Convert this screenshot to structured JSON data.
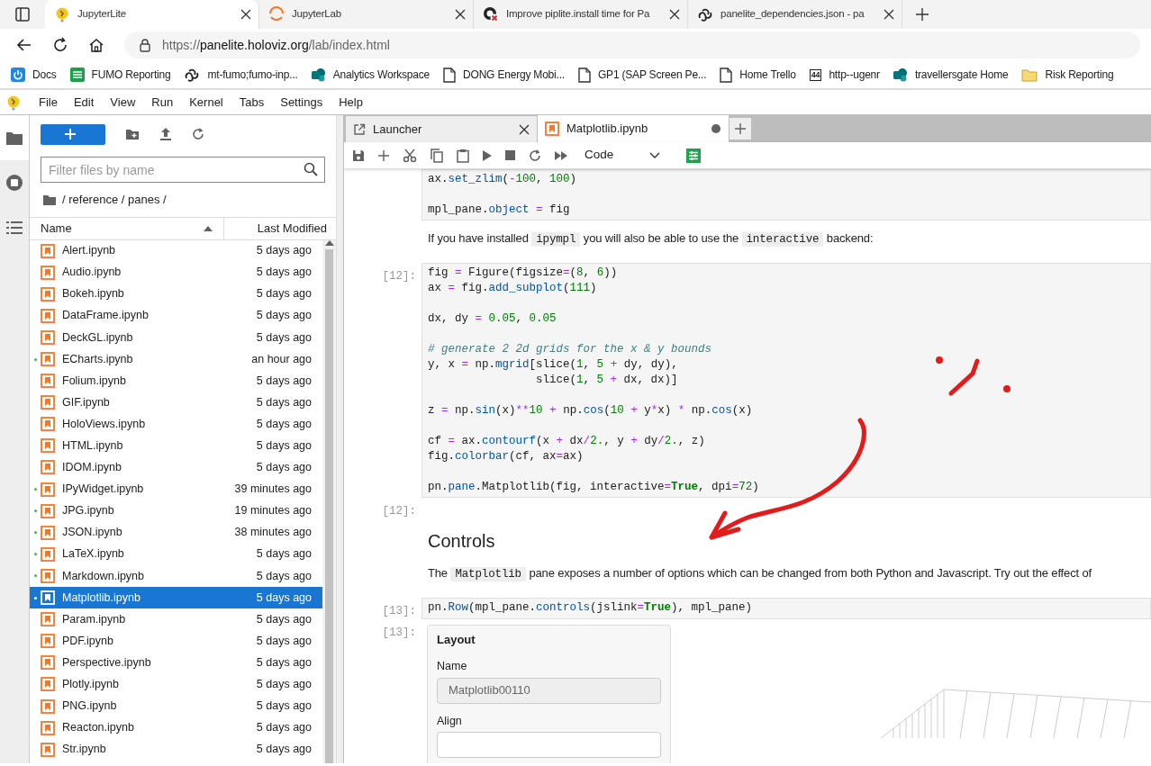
{
  "browser": {
    "tabs": [
      {
        "title": "JupyterLite",
        "kind": "jupyterlite",
        "selected": true
      },
      {
        "title": "JupyterLab",
        "kind": "jupyterlab",
        "selected": false
      },
      {
        "title": "Improve piplite.install time for Pa",
        "kind": "github-error",
        "selected": false
      },
      {
        "title": "panelite_dependencies.json - pa",
        "kind": "knot",
        "selected": false
      }
    ],
    "url": {
      "scheme": "https://",
      "host": "panelite.holoviz.org",
      "path": "/lab/index.html"
    },
    "bookmarks": [
      {
        "label": "Docs",
        "kind": "power"
      },
      {
        "label": "FUMO Reporting",
        "kind": "sheet"
      },
      {
        "label": "mt-fumo;fumo-inp...",
        "kind": "knot"
      },
      {
        "label": "Analytics Workspace",
        "kind": "circles"
      },
      {
        "label": "DONG Energy Mobi...",
        "kind": "page"
      },
      {
        "label": "GP1 (SAP Screen Pe...",
        "kind": "page"
      },
      {
        "label": "Home  Trello",
        "kind": "page"
      },
      {
        "label": "http--ugenr",
        "kind": "number",
        "badge": "44"
      },
      {
        "label": "travellersgate  Home",
        "kind": "circles"
      },
      {
        "label": "Risk Reporting",
        "kind": "folder"
      }
    ]
  },
  "menu": [
    "File",
    "Edit",
    "View",
    "Run",
    "Kernel",
    "Tabs",
    "Settings",
    "Help"
  ],
  "activity_bar": [
    {
      "kind": "files",
      "selected": true
    },
    {
      "kind": "running",
      "selected": false
    },
    {
      "kind": "toc",
      "selected": false
    }
  ],
  "file_browser": {
    "filter": {
      "placeholder": "Filter files by name"
    },
    "breadcrumb": "/ reference / panes /",
    "columns": [
      {
        "label": "Name",
        "sort_ascending": true
      },
      {
        "label": "Last Modified"
      }
    ],
    "files": [
      {
        "name": "Alert.ipynb",
        "modified": "5 days ago",
        "running": false,
        "selected": false
      },
      {
        "name": "Audio.ipynb",
        "modified": "5 days ago",
        "running": false,
        "selected": false
      },
      {
        "name": "Bokeh.ipynb",
        "modified": "5 days ago",
        "running": false,
        "selected": false
      },
      {
        "name": "DataFrame.ipynb",
        "modified": "5 days ago",
        "running": false,
        "selected": false
      },
      {
        "name": "DeckGL.ipynb",
        "modified": "5 days ago",
        "running": false,
        "selected": false
      },
      {
        "name": "ECharts.ipynb",
        "modified": "an hour ago",
        "running": true,
        "selected": false
      },
      {
        "name": "Folium.ipynb",
        "modified": "5 days ago",
        "running": false,
        "selected": false
      },
      {
        "name": "GIF.ipynb",
        "modified": "5 days ago",
        "running": false,
        "selected": false
      },
      {
        "name": "HoloViews.ipynb",
        "modified": "5 days ago",
        "running": false,
        "selected": false
      },
      {
        "name": "HTML.ipynb",
        "modified": "5 days ago",
        "running": false,
        "selected": false
      },
      {
        "name": "IDOM.ipynb",
        "modified": "5 days ago",
        "running": false,
        "selected": false
      },
      {
        "name": "IPyWidget.ipynb",
        "modified": "39 minutes ago",
        "running": true,
        "selected": false
      },
      {
        "name": "JPG.ipynb",
        "modified": "19 minutes ago",
        "running": true,
        "selected": false
      },
      {
        "name": "JSON.ipynb",
        "modified": "38 minutes ago",
        "running": true,
        "selected": false
      },
      {
        "name": "LaTeX.ipynb",
        "modified": "5 days ago",
        "running": true,
        "selected": false
      },
      {
        "name": "Markdown.ipynb",
        "modified": "5 days ago",
        "running": true,
        "selected": false
      },
      {
        "name": "Matplotlib.ipynb",
        "modified": "5 days ago",
        "running": true,
        "selected": true
      },
      {
        "name": "Param.ipynb",
        "modified": "5 days ago",
        "running": false,
        "selected": false
      },
      {
        "name": "PDF.ipynb",
        "modified": "5 days ago",
        "running": false,
        "selected": false
      },
      {
        "name": "Perspective.ipynb",
        "modified": "5 days ago",
        "running": false,
        "selected": false
      },
      {
        "name": "Plotly.ipynb",
        "modified": "5 days ago",
        "running": false,
        "selected": false
      },
      {
        "name": "PNG.ipynb",
        "modified": "5 days ago",
        "running": false,
        "selected": false
      },
      {
        "name": "Reacton.ipynb",
        "modified": "5 days ago",
        "running": false,
        "selected": false
      },
      {
        "name": "Str.ipynb",
        "modified": "5 days ago",
        "running": false,
        "selected": false
      }
    ]
  },
  "notebook_tabs": [
    {
      "title": "Launcher",
      "kind": "launcher",
      "selected": false,
      "dirty": false
    },
    {
      "title": "Matplotlib.ipynb",
      "kind": "notebook",
      "selected": true,
      "dirty": true
    }
  ],
  "toolbar": {
    "cell_type": "Code"
  },
  "cells": [
    {
      "kind": "code",
      "blocks": [
        [
          [
            {
              "text": "ax.",
              "kind": "name"
            },
            {
              "text": "set_zlim",
              "kind": "attr"
            },
            {
              "text": "(",
              "kind": "name"
            },
            {
              "text": "-",
              "kind": "op"
            },
            {
              "text": "100",
              "kind": "num"
            },
            {
              "text": ", ",
              "kind": "name"
            },
            {
              "text": "100",
              "kind": "num"
            },
            {
              "text": ")",
              "kind": "name"
            }
          ]
        ],
        [
          [
            {
              "text": "mpl_pane.",
              "kind": "name"
            },
            {
              "text": "object",
              "kind": "attr"
            },
            {
              "text": " = ",
              "kind": "op"
            },
            {
              "text": "fig",
              "kind": "name"
            }
          ]
        ]
      ]
    },
    {
      "kind": "markdown",
      "segments": [
        {
          "text": "If you have installed ",
          "kind": "plain"
        },
        {
          "text": "ipympl",
          "kind": "code"
        },
        {
          "text": " you will also be able to use the ",
          "kind": "plain"
        },
        {
          "text": "interactive",
          "kind": "code"
        },
        {
          "text": " backend:",
          "kind": "plain"
        }
      ]
    },
    {
      "kind": "code",
      "prompt": "[12]:",
      "blocks": [
        [
          [
            {
              "text": "fig",
              "kind": "name"
            },
            {
              "text": " = ",
              "kind": "op"
            },
            {
              "text": "Figure(figsize",
              "kind": "name"
            },
            {
              "text": "=",
              "kind": "op"
            },
            {
              "text": "(",
              "kind": "name"
            },
            {
              "text": "8",
              "kind": "num"
            },
            {
              "text": ", ",
              "kind": "name"
            },
            {
              "text": "6",
              "kind": "num"
            },
            {
              "text": "))",
              "kind": "name"
            }
          ],
          [
            {
              "text": "ax",
              "kind": "name"
            },
            {
              "text": " = ",
              "kind": "op"
            },
            {
              "text": "fig.",
              "kind": "name"
            },
            {
              "text": "add_subplot",
              "kind": "attr"
            },
            {
              "text": "(",
              "kind": "name"
            },
            {
              "text": "111",
              "kind": "num"
            },
            {
              "text": ")",
              "kind": "name"
            }
          ]
        ],
        [
          [
            {
              "text": "dx, dy",
              "kind": "name"
            },
            {
              "text": " = ",
              "kind": "op"
            },
            {
              "text": "0.05",
              "kind": "num"
            },
            {
              "text": ", ",
              "kind": "name"
            },
            {
              "text": "0.05",
              "kind": "num"
            }
          ]
        ],
        [
          [
            {
              "text": "# generate 2 2d grids for the x & y bounds",
              "kind": "comment"
            }
          ],
          [
            {
              "text": "y, x",
              "kind": "name"
            },
            {
              "text": " = ",
              "kind": "op"
            },
            {
              "text": "np.",
              "kind": "name"
            },
            {
              "text": "mgrid",
              "kind": "attr"
            },
            {
              "text": "[slice(",
              "kind": "name"
            },
            {
              "text": "1",
              "kind": "num"
            },
            {
              "text": ", ",
              "kind": "name"
            },
            {
              "text": "5",
              "kind": "num"
            },
            {
              "text": " + ",
              "kind": "op"
            },
            {
              "text": "dy, dy),",
              "kind": "name"
            }
          ],
          [
            {
              "text": "                slice(",
              "kind": "name"
            },
            {
              "text": "1",
              "kind": "num"
            },
            {
              "text": ", ",
              "kind": "name"
            },
            {
              "text": "5",
              "kind": "num"
            },
            {
              "text": " + ",
              "kind": "op"
            },
            {
              "text": "dx, dx)]",
              "kind": "name"
            }
          ]
        ],
        [
          [
            {
              "text": "z",
              "kind": "name"
            },
            {
              "text": " = ",
              "kind": "op"
            },
            {
              "text": "np.",
              "kind": "name"
            },
            {
              "text": "sin",
              "kind": "attr"
            },
            {
              "text": "(x)",
              "kind": "name"
            },
            {
              "text": "**",
              "kind": "op"
            },
            {
              "text": "10",
              "kind": "num"
            },
            {
              "text": " + ",
              "kind": "op"
            },
            {
              "text": "np.",
              "kind": "name"
            },
            {
              "text": "cos",
              "kind": "attr"
            },
            {
              "text": "(",
              "kind": "name"
            },
            {
              "text": "10",
              "kind": "num"
            },
            {
              "text": " + ",
              "kind": "op"
            },
            {
              "text": "y",
              "kind": "name"
            },
            {
              "text": "*",
              "kind": "op"
            },
            {
              "text": "x)",
              "kind": "name"
            },
            {
              "text": " * ",
              "kind": "op"
            },
            {
              "text": "np.",
              "kind": "name"
            },
            {
              "text": "cos",
              "kind": "attr"
            },
            {
              "text": "(x)",
              "kind": "name"
            }
          ]
        ],
        [
          [
            {
              "text": "cf",
              "kind": "name"
            },
            {
              "text": " = ",
              "kind": "op"
            },
            {
              "text": "ax.",
              "kind": "name"
            },
            {
              "text": "contourf",
              "kind": "attr"
            },
            {
              "text": "(x",
              "kind": "name"
            },
            {
              "text": " + ",
              "kind": "op"
            },
            {
              "text": "dx",
              "kind": "name"
            },
            {
              "text": "/",
              "kind": "op"
            },
            {
              "text": "2.",
              "kind": "num"
            },
            {
              "text": ", y",
              "kind": "name"
            },
            {
              "text": " + ",
              "kind": "op"
            },
            {
              "text": "dy",
              "kind": "name"
            },
            {
              "text": "/",
              "kind": "op"
            },
            {
              "text": "2.",
              "kind": "num"
            },
            {
              "text": ", z)",
              "kind": "name"
            }
          ],
          [
            {
              "text": "fig.",
              "kind": "name"
            },
            {
              "text": "colorbar",
              "kind": "attr"
            },
            {
              "text": "(cf, ax",
              "kind": "name"
            },
            {
              "text": "=",
              "kind": "op"
            },
            {
              "text": "ax)",
              "kind": "name"
            }
          ]
        ],
        [
          [
            {
              "text": "pn.",
              "kind": "name"
            },
            {
              "text": "pane",
              "kind": "attr"
            },
            {
              "text": ".Matplotlib(fig, interactive",
              "kind": "name"
            },
            {
              "text": "=",
              "kind": "op"
            },
            {
              "text": "True",
              "kind": "kw"
            },
            {
              "text": ", dpi",
              "kind": "name"
            },
            {
              "text": "=",
              "kind": "op"
            },
            {
              "text": "72",
              "kind": "num"
            },
            {
              "text": ")",
              "kind": "name"
            }
          ]
        ]
      ]
    },
    {
      "kind": "output",
      "prompt": "[12]:"
    },
    {
      "kind": "heading",
      "text": "Controls"
    },
    {
      "kind": "markdown",
      "segments": [
        {
          "text": "The ",
          "kind": "plain"
        },
        {
          "text": "Matplotlib",
          "kind": "code"
        },
        {
          "text": " pane exposes a number of options which can be changed from both Python and Javascript. Try out the effect of",
          "kind": "plain"
        }
      ]
    },
    {
      "kind": "code",
      "prompt": "[13]:",
      "blocks": [
        [
          [
            {
              "text": "pn.",
              "kind": "name"
            },
            {
              "text": "Row",
              "kind": "attr"
            },
            {
              "text": "(mpl_pane.",
              "kind": "name"
            },
            {
              "text": "controls",
              "kind": "attr"
            },
            {
              "text": "(jslink",
              "kind": "name"
            },
            {
              "text": "=",
              "kind": "op"
            },
            {
              "text": "True",
              "kind": "kw"
            },
            {
              "text": "), mpl_pane)",
              "kind": "name"
            }
          ]
        ]
      ]
    },
    {
      "kind": "widget",
      "prompt": "[13]:",
      "title": "Layout",
      "fields": [
        {
          "label": "Name",
          "value": "Matplotlib00110",
          "disabled": true
        },
        {
          "label": "Align",
          "disabled": false
        }
      ]
    }
  ]
}
